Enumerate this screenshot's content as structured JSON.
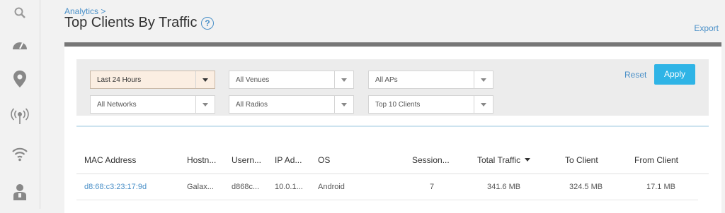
{
  "rail": {
    "icons": [
      "search-icon",
      "dashboard-gauge-icon",
      "location-pin-icon",
      "access-point-icon",
      "wifi-icon",
      "user-icon"
    ]
  },
  "header": {
    "breadcrumb": "Analytics >",
    "title": "Top Clients By Traffic",
    "help": "?",
    "export_label": "Export"
  },
  "filters": {
    "time": "Last 24 Hours",
    "venues": "All Venues",
    "aps": "All APs",
    "networks": "All Networks",
    "radios": "All Radios",
    "clients": "Top 10 Clients",
    "reset_label": "Reset",
    "apply_label": "Apply"
  },
  "table": {
    "columns": [
      "MAC Address",
      "Hostn...",
      "Usern...",
      "IP Ad...",
      "OS",
      "Session...",
      "Total Traffic",
      "To Client",
      "From Client"
    ],
    "sort_column": "Total Traffic",
    "rows": [
      {
        "mac": "d8:68:c3:23:17:9d",
        "hostname": "Galax...",
        "username": "d868c...",
        "ip": "10.0.1...",
        "os": "Android",
        "sessions": "7",
        "total_traffic": "341.6 MB",
        "to_client": "324.5 MB",
        "from_client": "17.1 MB"
      }
    ]
  },
  "colors": {
    "accent": "#4a90c8",
    "apply_button": "#2fb4e6",
    "panel_top_border": "#777777",
    "active_filter": "#fbeee2"
  }
}
